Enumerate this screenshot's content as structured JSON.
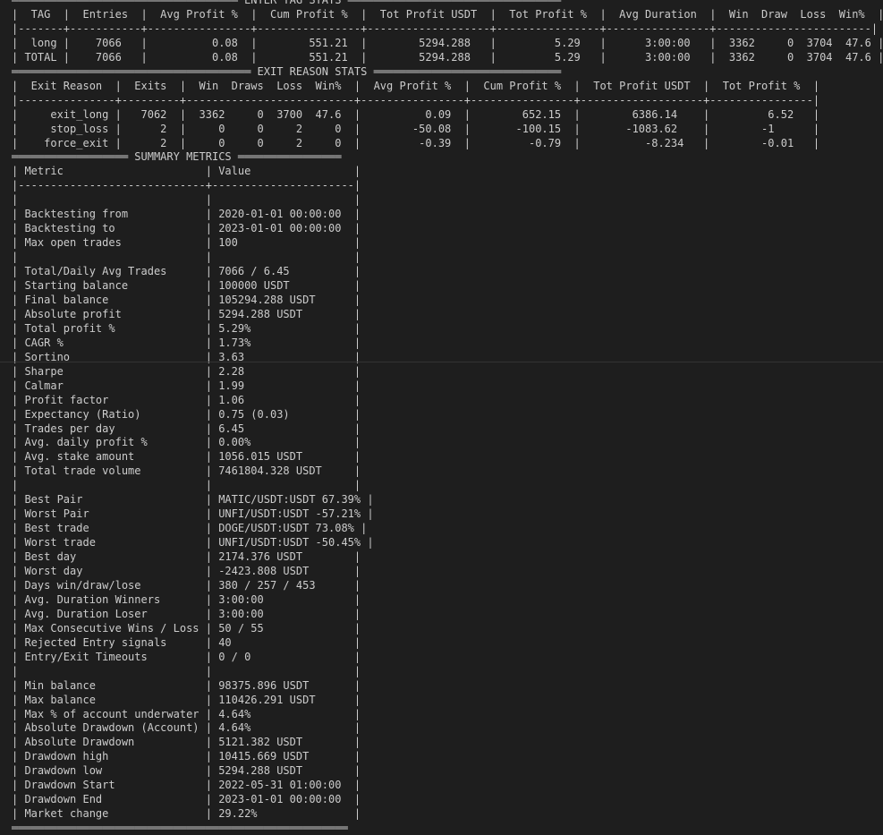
{
  "terminal": {
    "background": "#1e1e1e",
    "foreground": "#cccccc",
    "lines": [
      "═══════════════════════════════════ ENTER TAG STATS ═════════════════════════════════",
      "|  TAG  |  Entries  |  Avg Profit %  |  Cum Profit %  |  Tot Profit USDT  |  Tot Profit %  |  Avg Duration  |  Win  Draw  Loss  Win%  |",
      "|-------+-----------+----------------+----------------+-------------------+----------------+----------------+------------------------|",
      "|  long |    7066   |          0.08  |        551.21  |        5294.288   |         5.29   |      3:00:00   |  3362     0  3704  47.6 |",
      "| TOTAL |    7066   |          0.08  |        551.21  |        5294.288   |         5.29   |      3:00:00   |  3362     0  3704  47.6 |",
      "═════════════════════════════════════ EXIT REASON STATS ═════════════════════════════",
      "|  Exit Reason  |  Exits  |  Win  Draws  Loss  Win%  |  Avg Profit %  |  Cum Profit %  |  Tot Profit USDT  |  Tot Profit %  |",
      "|---------------+---------+--------------------------+----------------+----------------+-------------------+----------------|",
      "|     exit_long |   7062  |  3362     0  3700  47.6  |          0.09  |        652.15  |        6386.14    |         6.52   |",
      "|     stop_loss |      2  |     0     0     2     0  |        -50.08  |       -100.15  |       -1083.62    |        -1      |",
      "|    force_exit |      2  |     0     0     2     0  |         -0.39  |         -0.79  |          -8.234   |        -0.01   |",
      "══════════════════ SUMMARY METRICS ════════════════",
      "| Metric                      | Value                |",
      "|-----------------------------+----------------------|",
      "|                             |                      |",
      "| Backtesting from            | 2020-01-01 00:00:00  |",
      "| Backtesting to              | 2023-01-01 00:00:00  |",
      "| Max open trades             | 100                  |",
      "|                             |                      |",
      "| Total/Daily Avg Trades      | 7066 / 6.45          |",
      "| Starting balance            | 100000 USDT          |",
      "| Final balance               | 105294.288 USDT      |",
      "| Absolute profit             | 5294.288 USDT        |",
      "| Total profit %              | 5.29%                |",
      "| CAGR %                      | 1.73%                |",
      "| Sortino                     | 3.63                 |",
      "| Sharpe                      | 2.28                 |",
      "| Calmar                      | 1.99                 |",
      "| Profit factor               | 1.06                 |",
      "| Expectancy (Ratio)          | 0.75 (0.03)          |",
      "| Trades per day              | 6.45                 |",
      "| Avg. daily profit %         | 0.00%                |",
      "| Avg. stake amount           | 1056.015 USDT        |",
      "| Total trade volume          | 7461804.328 USDT     |",
      "|                             |                      |",
      "| Best Pair                   | MATIC/USDT:USDT 67.39% |",
      "| Worst Pair                  | UNFI/USDT:USDT -57.21% |",
      "| Best trade                  | DOGE/USDT:USDT 73.08% |",
      "| Worst trade                 | UNFI/USDT:USDT -50.45% |",
      "| Best day                    | 2174.376 USDT        |",
      "| Worst day                   | -2423.808 USDT       |",
      "| Days win/draw/lose          | 380 / 257 / 453      |",
      "| Avg. Duration Winners       | 3:00:00              |",
      "| Avg. Duration Loser         | 3:00:00              |",
      "| Max Consecutive Wins / Loss | 50 / 55              |",
      "| Rejected Entry signals      | 40                   |",
      "| Entry/Exit Timeouts         | 0 / 0                |",
      "|                             |                      |",
      "| Min balance                 | 98375.896 USDT       |",
      "| Max balance                 | 110426.291 USDT      |",
      "| Max % of account underwater | 4.64%                |",
      "| Absolute Drawdown (Account) | 4.64%                |",
      "| Absolute Drawdown           | 5121.382 USDT        |",
      "| Drawdown high               | 10415.669 USDT       |",
      "| Drawdown low                | 5294.288 USDT        |",
      "| Drawdown Start              | 2022-05-31 01:00:00  |",
      "| Drawdown End                | 2023-01-01 00:00:00  |",
      "| Market change               | 29.22%               |",
      "════════════════════════════════════════════════════"
    ]
  }
}
